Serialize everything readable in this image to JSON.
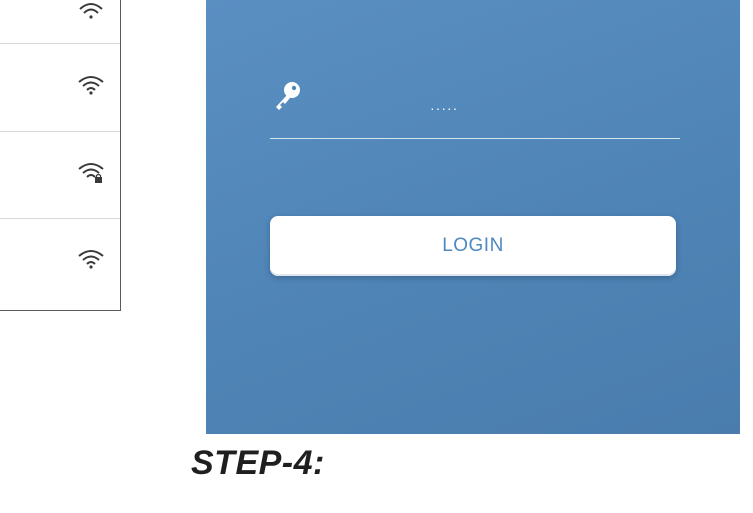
{
  "wifi_list": {
    "networks": [
      {
        "signal_icon": "wifi-icon",
        "secured": false
      },
      {
        "signal_icon": "wifi-icon",
        "secured": false
      },
      {
        "signal_icon": "wifi-lock-icon",
        "secured": true
      },
      {
        "signal_icon": "wifi-icon",
        "secured": false
      }
    ]
  },
  "login": {
    "password_icon": "key-icon",
    "password_value": "·····",
    "button_label": "LOGIN"
  },
  "caption": {
    "step": "STEP-4:"
  },
  "colors": {
    "panel_blue": "#5087b9",
    "button_text": "#4f88c0",
    "icon_dark": "#3a3a3a"
  }
}
